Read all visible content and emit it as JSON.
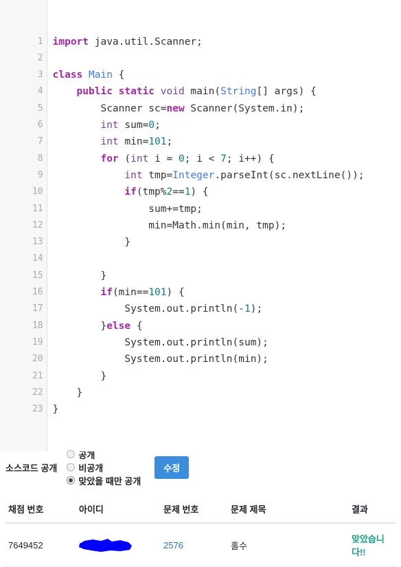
{
  "code": {
    "language": "java",
    "lines": [
      {
        "n": "1",
        "tokens": [
          {
            "c": "k",
            "s": "import"
          },
          {
            "c": "pl",
            "s": " java.util.Scanner;"
          }
        ]
      },
      {
        "n": "2",
        "tokens": []
      },
      {
        "n": "3",
        "tokens": [
          {
            "c": "k",
            "s": "class"
          },
          {
            "c": "pl",
            "s": " "
          },
          {
            "c": "cn",
            "s": "Main"
          },
          {
            "c": "pl",
            "s": " {"
          }
        ]
      },
      {
        "n": "4",
        "tokens": [
          {
            "c": "pl",
            "s": "    "
          },
          {
            "c": "k",
            "s": "public static"
          },
          {
            "c": "pl",
            "s": " "
          },
          {
            "c": "t",
            "s": "void"
          },
          {
            "c": "pl",
            "s": " main("
          },
          {
            "c": "cn",
            "s": "String"
          },
          {
            "c": "pl",
            "s": "[] args) {"
          }
        ]
      },
      {
        "n": "5",
        "tokens": [
          {
            "c": "pl",
            "s": "        Scanner sc="
          },
          {
            "c": "k",
            "s": "new"
          },
          {
            "c": "pl",
            "s": " Scanner(System.in);"
          }
        ]
      },
      {
        "n": "6",
        "tokens": [
          {
            "c": "pl",
            "s": "        "
          },
          {
            "c": "t",
            "s": "int"
          },
          {
            "c": "pl",
            "s": " sum="
          },
          {
            "c": "nu",
            "s": "0"
          },
          {
            "c": "pl",
            "s": ";"
          }
        ]
      },
      {
        "n": "7",
        "tokens": [
          {
            "c": "pl",
            "s": "        "
          },
          {
            "c": "t",
            "s": "int"
          },
          {
            "c": "pl",
            "s": " min="
          },
          {
            "c": "nu",
            "s": "101"
          },
          {
            "c": "pl",
            "s": ";"
          }
        ]
      },
      {
        "n": "8",
        "tokens": [
          {
            "c": "pl",
            "s": "        "
          },
          {
            "c": "k",
            "s": "for"
          },
          {
            "c": "pl",
            "s": " ("
          },
          {
            "c": "t",
            "s": "int"
          },
          {
            "c": "pl",
            "s": " i = "
          },
          {
            "c": "nu",
            "s": "0"
          },
          {
            "c": "pl",
            "s": "; i < "
          },
          {
            "c": "nu",
            "s": "7"
          },
          {
            "c": "pl",
            "s": "; i++) {"
          }
        ]
      },
      {
        "n": "9",
        "tokens": [
          {
            "c": "pl",
            "s": "            "
          },
          {
            "c": "t",
            "s": "int"
          },
          {
            "c": "pl",
            "s": " tmp="
          },
          {
            "c": "cn",
            "s": "Integer"
          },
          {
            "c": "pl",
            "s": ".parseInt(sc.nextLine());"
          }
        ]
      },
      {
        "n": "10",
        "tokens": [
          {
            "c": "pl",
            "s": "            "
          },
          {
            "c": "k",
            "s": "if"
          },
          {
            "c": "pl",
            "s": "(tmp%"
          },
          {
            "c": "nu",
            "s": "2"
          },
          {
            "c": "pl",
            "s": "=="
          },
          {
            "c": "nu",
            "s": "1"
          },
          {
            "c": "pl",
            "s": ") {"
          }
        ]
      },
      {
        "n": "11",
        "tokens": [
          {
            "c": "pl",
            "s": "                sum+=tmp;"
          }
        ]
      },
      {
        "n": "12",
        "tokens": [
          {
            "c": "pl",
            "s": "                min=Math.min(min, tmp);"
          }
        ]
      },
      {
        "n": "13",
        "tokens": [
          {
            "c": "pl",
            "s": "            }"
          }
        ]
      },
      {
        "n": "14",
        "tokens": []
      },
      {
        "n": "15",
        "tokens": [
          {
            "c": "pl",
            "s": "        }"
          }
        ]
      },
      {
        "n": "16",
        "tokens": [
          {
            "c": "pl",
            "s": "        "
          },
          {
            "c": "k",
            "s": "if"
          },
          {
            "c": "pl",
            "s": "(min=="
          },
          {
            "c": "nu",
            "s": "101"
          },
          {
            "c": "pl",
            "s": ") {"
          }
        ]
      },
      {
        "n": "17",
        "tokens": [
          {
            "c": "pl",
            "s": "            System.out.println(-"
          },
          {
            "c": "nu",
            "s": "1"
          },
          {
            "c": "pl",
            "s": ");"
          }
        ]
      },
      {
        "n": "18",
        "tokens": [
          {
            "c": "pl",
            "s": "        }"
          },
          {
            "c": "k",
            "s": "else"
          },
          {
            "c": "pl",
            "s": " {"
          }
        ]
      },
      {
        "n": "19",
        "tokens": [
          {
            "c": "pl",
            "s": "            System.out.println(sum);"
          }
        ]
      },
      {
        "n": "20",
        "tokens": [
          {
            "c": "pl",
            "s": "            System.out.println(min);"
          }
        ]
      },
      {
        "n": "21",
        "tokens": [
          {
            "c": "pl",
            "s": "        }"
          }
        ]
      },
      {
        "n": "22",
        "tokens": [
          {
            "c": "pl",
            "s": "    }"
          }
        ]
      },
      {
        "n": "23",
        "tokens": [
          {
            "c": "pl",
            "s": "}"
          }
        ]
      }
    ]
  },
  "share": {
    "label": "소스코드 공개",
    "options": [
      {
        "label": "공개",
        "selected": false
      },
      {
        "label": "비공개",
        "selected": false
      },
      {
        "label": "맞았을 때만 공개",
        "selected": true
      }
    ],
    "edit_button": "수정"
  },
  "results": {
    "headers": [
      "채점 번호",
      "아이디",
      "문제 번호",
      "문제 제목",
      "결과"
    ],
    "rows": [
      {
        "solution_id": "7649452",
        "user_id": "",
        "problem_number": "2576",
        "problem_title": "홀수",
        "result": "맞았습니다!!"
      }
    ]
  },
  "colors": {
    "accent_blue": "#3c8dde",
    "link_blue": "#2f6fb5",
    "accepted_green": "#16a085",
    "redaction": "#0000ff"
  }
}
